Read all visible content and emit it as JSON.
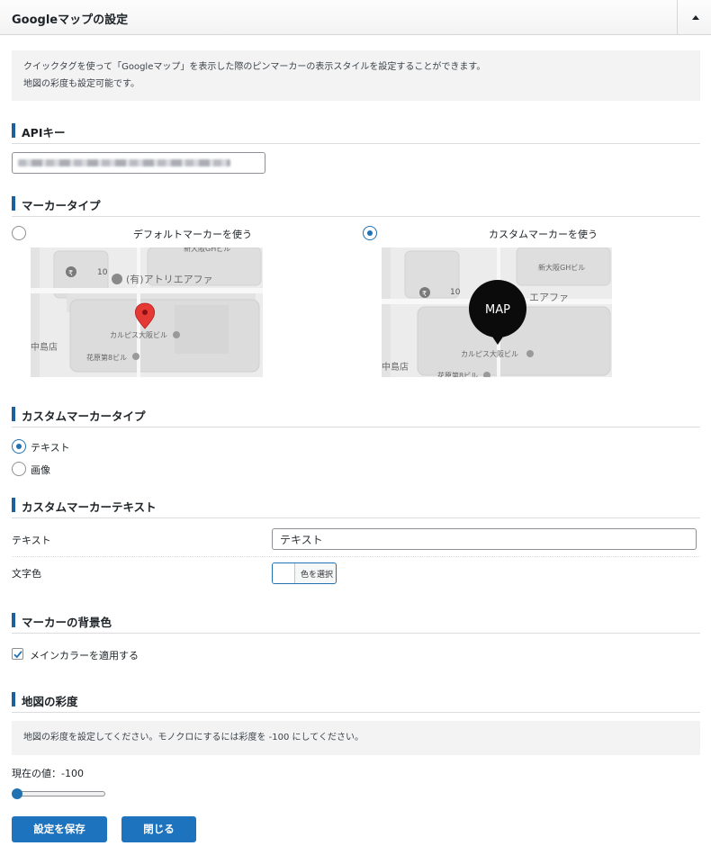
{
  "panel": {
    "title": "Googleマップの設定",
    "toggle_icon": "triangle-up-icon"
  },
  "intro_note": {
    "line1": "クイックタグを使って「Googleマップ」を表示した際のピンマーカーの表示スタイルを設定することができます。",
    "line2": "地図の彩度も設定可能です。"
  },
  "api_key": {
    "heading": "APIキー",
    "value": ""
  },
  "marker_type": {
    "heading": "マーカータイプ",
    "options": [
      {
        "label": "デフォルトマーカーを使う",
        "selected": false
      },
      {
        "label": "カスタムマーカーを使う",
        "selected": true
      }
    ],
    "map_labels": {
      "building_top": "新大阪GHビル",
      "number": "10",
      "atelier": "(有)アトリエアファ",
      "atelier_short": "エアファ",
      "calpis": "カルピス大阪ビル",
      "kahara": "花原第8ビル",
      "nakajima": "中島店"
    },
    "custom_marker_text": "MAP"
  },
  "custom_marker_type": {
    "heading": "カスタムマーカータイプ",
    "options": [
      {
        "label": "テキスト",
        "selected": true
      },
      {
        "label": "画像",
        "selected": false
      }
    ]
  },
  "custom_marker_text": {
    "heading": "カスタムマーカーテキスト",
    "text_label": "テキスト",
    "text_value": "テキスト",
    "color_label": "文字色",
    "color_button": "色を選択"
  },
  "marker_bg": {
    "heading": "マーカーの背景色",
    "checkbox_label": "メインカラーを適用する",
    "checked": true
  },
  "saturation": {
    "heading": "地図の彩度",
    "note": "地図の彩度を設定してください。モノクロにするには彩度を -100 にしてください。",
    "current_label": "現在の値：-100",
    "min": -100,
    "max": 100,
    "value": -100
  },
  "buttons": {
    "save": "設定を保存",
    "close": "閉じる"
  },
  "colors": {
    "accent": "#2271b1",
    "button": "#1e73be",
    "section_bar": "#1e5fa0",
    "pin_red": "#e53935"
  }
}
